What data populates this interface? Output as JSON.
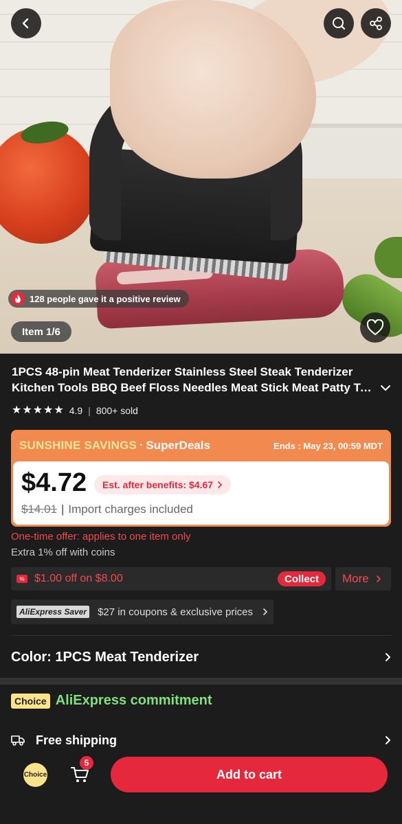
{
  "hero": {
    "review_text": "128 people gave it a positive review",
    "item_counter": "Item 1/6"
  },
  "product": {
    "title_line1": "1PCS 48-pin Meat Tenderizer Stainless Steel Steak Tenderizer",
    "title_line2": "Kitchen Tools BBQ Beef Floss Needles Meat Stick Meat Patty Tools",
    "rating": "4.9",
    "sold": "800+ sold",
    "stars": 5
  },
  "deal": {
    "brand": "SUNSHINE SAVINGS",
    "dot": "·",
    "super": "SuperDeals",
    "ends": "Ends : May 23, 00:59 MDT",
    "price": "$4.72",
    "est_benefits": "Est. after benefits: $4.67",
    "old_price": "$14.01",
    "separator": "|",
    "import_note": "Import charges included"
  },
  "offers": {
    "one_time": "One-time offer: applies to one item only",
    "extra_coins": "Extra 1% off with coins",
    "coupon": "$1.00 off on $8.00",
    "collect": "Collect",
    "more": "More",
    "saver_logo": "AliExpress Saver",
    "saver_text": "$27 in coupons & exclusive prices"
  },
  "color": {
    "label": "Color: 1PCS Meat Tenderizer"
  },
  "commitment": {
    "badge": "Choice",
    "title": "AliExpress commitment",
    "shipping": "Free shipping"
  },
  "bottom": {
    "choice": "Choice",
    "cart_count": "5",
    "add_to_cart": "Add to cart"
  },
  "colors": {
    "accent_red": "#e5283b",
    "deal_orange": "#f28a4f",
    "choice_yellow": "#fde38c",
    "commit_green": "#7ee07e"
  }
}
